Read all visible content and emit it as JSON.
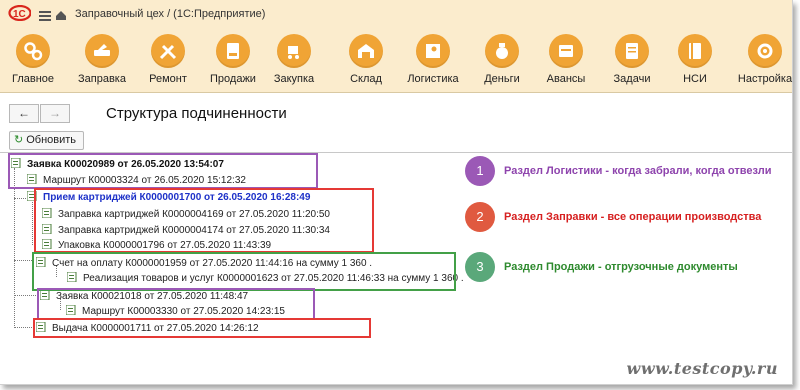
{
  "window": {
    "logo_text": "1С",
    "title": "Заправочный цех /   (1С:Предприятие)"
  },
  "toolbar": {
    "items": [
      {
        "label": "Главное",
        "icon": "gears-icon"
      },
      {
        "label": "Заправка",
        "icon": "cartridge-icon"
      },
      {
        "label": "Ремонт",
        "icon": "tools-icon"
      },
      {
        "label": "Продажи",
        "icon": "sale-icon"
      },
      {
        "label": "Закупка",
        "icon": "cart-icon"
      },
      {
        "label": "Склад",
        "icon": "warehouse-icon"
      },
      {
        "label": "Логистика",
        "icon": "map-icon"
      },
      {
        "label": "Деньги",
        "icon": "money-bag-icon"
      },
      {
        "label": "Авансы",
        "icon": "advance-icon"
      },
      {
        "label": "Задачи",
        "icon": "tasks-icon"
      },
      {
        "label": "НСИ",
        "icon": "book-icon"
      },
      {
        "label": "Настройка",
        "icon": "settings-icon"
      }
    ]
  },
  "nav": {
    "back": "←",
    "forward": "→"
  },
  "page": {
    "title": "Структура подчиненности",
    "refresh_label": "Обновить"
  },
  "tree": {
    "rows": [
      "Заявка К00020989 от 26.05.2020 13:54:07",
      "Маршрут К00003324 от 26.05.2020 15:12:32",
      "Прием картриджей К0000001700 от 26.05.2020 16:28:49",
      "Заправка картриджей К0000004169 от 27.05.2020 11:20:50",
      "Заправка картриджей К0000004174 от 27.05.2020 11:30:34",
      "Упаковка К0000001796 от 27.05.2020 11:43:39",
      "Счет на оплату К0000001959 от 27.05.2020 11:44:16 на сумму 1 360 .",
      "Реализация товаров и услуг К0000001623 от 27.05.2020 11:46:33 на сумму 1 360 .",
      "Заявка К00021018 от 27.05.2020 11:48:47",
      "Маршрут К00003330 от 27.05.2020 14:23:15",
      "Выдача К0000001711 от 27.05.2020 14:26:12"
    ]
  },
  "legend": [
    {
      "number": "1",
      "text": "Раздел Логистики - когда забрали, когда отвезли",
      "color": "#9b59b6",
      "text_color": "#8e44ad"
    },
    {
      "number": "2",
      "text": "Раздел Заправки - все операции производства",
      "color": "#e05a40",
      "text_color": "#d62020"
    },
    {
      "number": "3",
      "text": "Раздел Продажи - отгрузочные документы",
      "color": "#5aa87a",
      "text_color": "#2e8a2e"
    }
  ],
  "watermark": "www.testcopy.ru",
  "colors": {
    "toolbar_bg": "#fbeccd",
    "icon_circle": "#f0a435",
    "box_purple": "#9b59b6",
    "box_red": "#e53935",
    "box_green": "#43a047"
  }
}
